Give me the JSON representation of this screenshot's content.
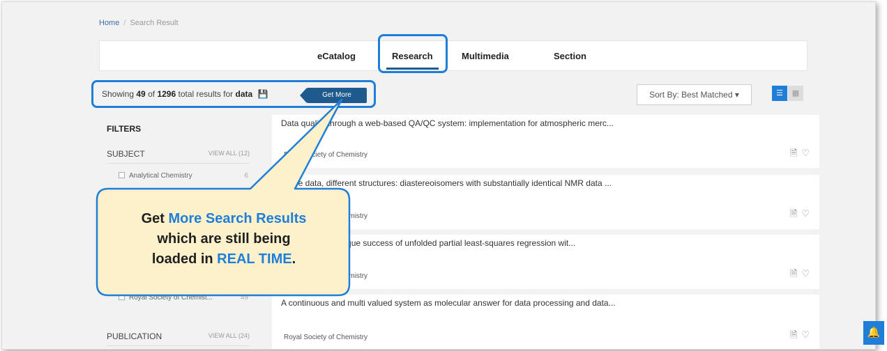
{
  "breadcrumb": {
    "home": "Home",
    "separator": "/",
    "current": "Search Result"
  },
  "tabs": [
    {
      "label": "eCatalog",
      "active": false
    },
    {
      "label": "Research",
      "active": true
    },
    {
      "label": "Multimedia",
      "active": false
    },
    {
      "label": "Section",
      "active": false
    }
  ],
  "results": {
    "prefix": "Showing",
    "shown": "49",
    "of": "of",
    "total": "1296",
    "suffix": "total results for",
    "query": "data",
    "save_icon": "save-icon",
    "get_more_label": "Get More"
  },
  "sort": {
    "label": "Sort By: Best Matched",
    "caret": "▾"
  },
  "view_toggle": {
    "list_icon": "list-view-icon",
    "grid_icon": "grid-view-icon"
  },
  "filters": {
    "title": "FILTERS",
    "subject": {
      "label": "SUBJECT",
      "view_all": "VIEW ALL (12)",
      "items": [
        {
          "label": "Analytical Chemistry",
          "count": "6"
        }
      ]
    },
    "publisher_item": {
      "label": "Royal Society of Chemist...",
      "count": "49"
    },
    "publication": {
      "label": "PUBLICATION",
      "view_all": "VIEW ALL (24)"
    }
  },
  "cards": [
    {
      "title": "Data quality through a web-based QA/QC system: implementation for atmospheric merc...",
      "publisher": "Royal Society of Chemistry"
    },
    {
      "title": "Same data, different structures: diastereoisomers with substantially identical NMR data ...",
      "publisher": "Royal Society of Chemistry"
    },
    {
      "title": "Less is better: unique success of unfolded partial least-squares regression wit...",
      "publisher": "Royal Society of Chemistry"
    },
    {
      "title": "A continuous and multi valued system as molecular answer for data processing and data...",
      "publisher": "Royal Society of Chemistry"
    }
  ],
  "card_icons": {
    "doc": "document-icon",
    "fav": "heart-icon"
  },
  "callout": {
    "part1": "Get ",
    "highlight1": "More Search Results",
    "line2": "which are still being",
    "part3": "loaded in ",
    "highlight2": "REAL TIME",
    "end": "."
  },
  "notification": {
    "icon": "bell-icon"
  },
  "colors": {
    "accent": "#1e7ed8",
    "button": "#1e5a8e",
    "callout_fill": "#fdf1cc",
    "callout_border": "#1e7ed8"
  }
}
